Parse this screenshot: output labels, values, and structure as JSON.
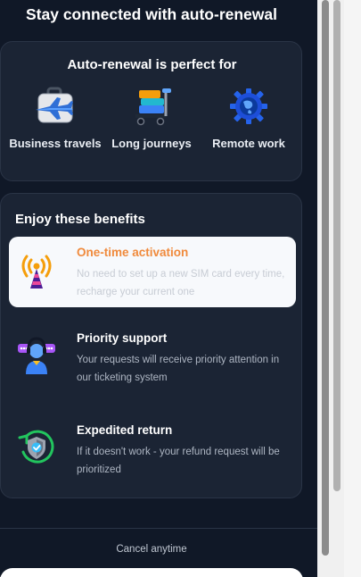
{
  "heading": "Stay connected with auto-renewal",
  "use_cases": {
    "title": "Auto-renewal is perfect for",
    "items": [
      {
        "label": "Business travels",
        "icon": "suitcase-plane-icon"
      },
      {
        "label": "Long journeys",
        "icon": "luggage-cart-icon"
      },
      {
        "label": "Remote work",
        "icon": "gear-globe-icon"
      }
    ]
  },
  "benefits": {
    "title": "Enjoy these benefits",
    "items": [
      {
        "title": "One-time activation",
        "description": "No need to set up a new SIM card every time, recharge your current one",
        "icon": "signal-tower-icon",
        "active": true
      },
      {
        "title": "Priority support",
        "description": "Your requests will receive priority attention in our ticketing system",
        "icon": "support-agent-icon",
        "active": false
      },
      {
        "title": "Expedited return",
        "description": "If it doesn't work - your refund request will be prioritized",
        "icon": "shield-check-icon",
        "active": false
      }
    ]
  },
  "footer": {
    "cancel_text": "Cancel anytime"
  },
  "colors": {
    "background": "#101827",
    "card": "#1b2434",
    "accent": "#f08a3c"
  }
}
